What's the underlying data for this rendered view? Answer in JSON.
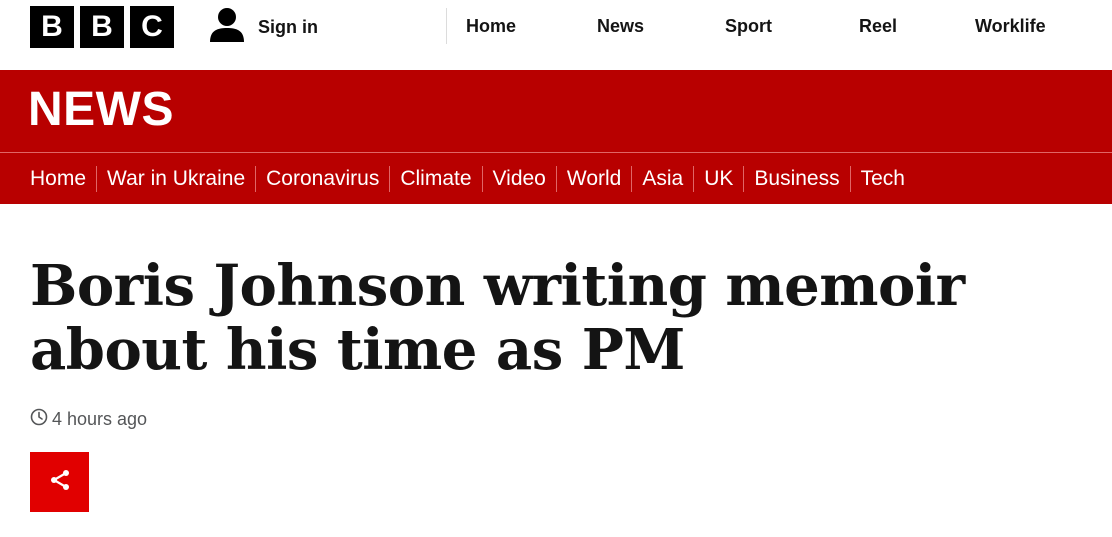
{
  "brand": {
    "logo_letters": [
      "B",
      "B",
      "C"
    ]
  },
  "account": {
    "signin_label": "Sign in",
    "icon": "user-icon"
  },
  "top_nav": {
    "items": [
      "Home",
      "News",
      "Sport",
      "Reel",
      "Worklife"
    ]
  },
  "section": {
    "title": "NEWS",
    "color": "#b80000"
  },
  "section_nav": {
    "items": [
      "Home",
      "War in Ukraine",
      "Coronavirus",
      "Climate",
      "Video",
      "World",
      "Asia",
      "UK",
      "Business",
      "Tech"
    ],
    "active": "UK"
  },
  "article": {
    "headline": "Boris Johnson writing memoir about his time as PM",
    "timestamp": "4 hours ago",
    "time_icon": "clock-icon",
    "share_icon": "share-icon",
    "share_color": "#e10000"
  }
}
